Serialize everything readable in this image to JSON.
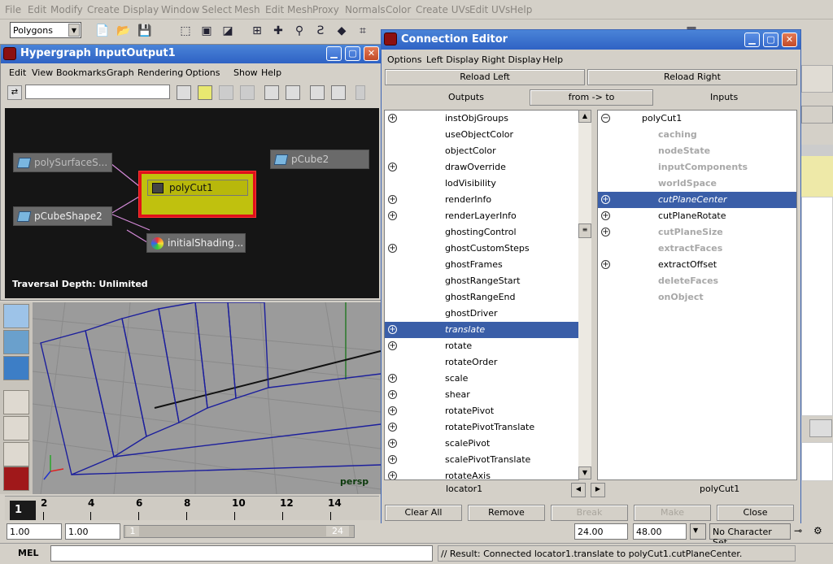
{
  "menubar": {
    "items": [
      "File",
      "Edit",
      "Modify",
      "Create",
      "Display",
      "Window",
      "Select",
      "Mesh",
      "Edit Mesh",
      "Proxy",
      "Normals",
      "Color",
      "Create UVs",
      "Edit UVs",
      "Help"
    ]
  },
  "shelf": {
    "mode": "Polygons"
  },
  "hypergraph": {
    "title": "Hypergraph InputOutput1",
    "menu": [
      "Edit",
      "View",
      "Bookmarks",
      "Graph",
      "Rendering",
      "Options",
      "Show",
      "Help"
    ],
    "nodes": {
      "poly_surface": "polySurfaceS...",
      "pcube_shape": "pCubeShape2",
      "poly_cut": "polyCut1",
      "pcube2": "pCube2",
      "initial_shading": "initialShading..."
    },
    "traversal": "Traversal Depth: Unlimited"
  },
  "viewport": {
    "camera": "persp"
  },
  "connection_editor": {
    "title": "Connection Editor",
    "menu": [
      "Options",
      "Left Display",
      "Right Display",
      "Help"
    ],
    "reload_left": "Reload Left",
    "reload_right": "Reload Right",
    "outputs": "Outputs",
    "direction": "from -> to",
    "inputs": "Inputs",
    "left_items": [
      {
        "label": "instObjGroups",
        "plus": true
      },
      {
        "label": "useObjectColor",
        "plus": false
      },
      {
        "label": "objectColor",
        "plus": false
      },
      {
        "label": "drawOverride",
        "plus": true
      },
      {
        "label": "lodVisibility",
        "plus": false
      },
      {
        "label": "renderInfo",
        "plus": true
      },
      {
        "label": "renderLayerInfo",
        "plus": true
      },
      {
        "label": "ghostingControl",
        "plus": false
      },
      {
        "label": "ghostCustomSteps",
        "plus": true
      },
      {
        "label": "ghostFrames",
        "plus": false
      },
      {
        "label": "ghostRangeStart",
        "plus": false
      },
      {
        "label": "ghostRangeEnd",
        "plus": false
      },
      {
        "label": "ghostDriver",
        "plus": false
      },
      {
        "label": "translate",
        "plus": true,
        "selected": true
      },
      {
        "label": "rotate",
        "plus": true
      },
      {
        "label": "rotateOrder",
        "plus": false
      },
      {
        "label": "scale",
        "plus": true
      },
      {
        "label": "shear",
        "plus": true
      },
      {
        "label": "rotatePivot",
        "plus": true
      },
      {
        "label": "rotatePivotTranslate",
        "plus": true
      },
      {
        "label": "scalePivot",
        "plus": true
      },
      {
        "label": "scalePivotTranslate",
        "plus": true
      },
      {
        "label": "rotateAxis",
        "plus": true
      }
    ],
    "right_items": [
      {
        "label": "polyCut1",
        "minus": true,
        "indent": 0
      },
      {
        "label": "caching",
        "dim": true,
        "indent": 1
      },
      {
        "label": "nodeState",
        "dim": true,
        "indent": 1
      },
      {
        "label": "inputComponents",
        "dim": true,
        "indent": 1
      },
      {
        "label": "worldSpace",
        "dim": true,
        "indent": 1
      },
      {
        "label": "cutPlaneCenter",
        "plus": true,
        "selected": true,
        "indent": 1
      },
      {
        "label": "cutPlaneRotate",
        "plus": true,
        "indent": 1
      },
      {
        "label": "cutPlaneSize",
        "plus": true,
        "dim": true,
        "indent": 1
      },
      {
        "label": "extractFaces",
        "dim": true,
        "indent": 1
      },
      {
        "label": "extractOffset",
        "plus": true,
        "indent": 1
      },
      {
        "label": "deleteFaces",
        "dim": true,
        "indent": 1
      },
      {
        "label": "onObject",
        "dim": true,
        "indent": 1
      }
    ],
    "left_node": "locator1",
    "right_node": "polyCut1",
    "buttons": {
      "clear_all": "Clear All",
      "remove": "Remove",
      "break": "Break",
      "make": "Make",
      "close": "Close"
    }
  },
  "timeline": {
    "ticks": [
      "2",
      "4",
      "6",
      "8",
      "10",
      "12",
      "14"
    ],
    "current": "1"
  },
  "range": {
    "start": "1.00",
    "start2": "1.00",
    "slider_start": "1",
    "slider_end": "24",
    "end": "24.00",
    "end2": "48.00",
    "char_set": "No Character Set"
  },
  "command": {
    "label": "MEL",
    "result": "// Result: Connected locator1.translate to polyCut1.cutPlaneCenter."
  },
  "colors": {
    "title_bar": "#2f62c4",
    "selection": "#3a5ea8",
    "selected_node": "#c0c10e",
    "highlight_border": "#e0101a"
  }
}
